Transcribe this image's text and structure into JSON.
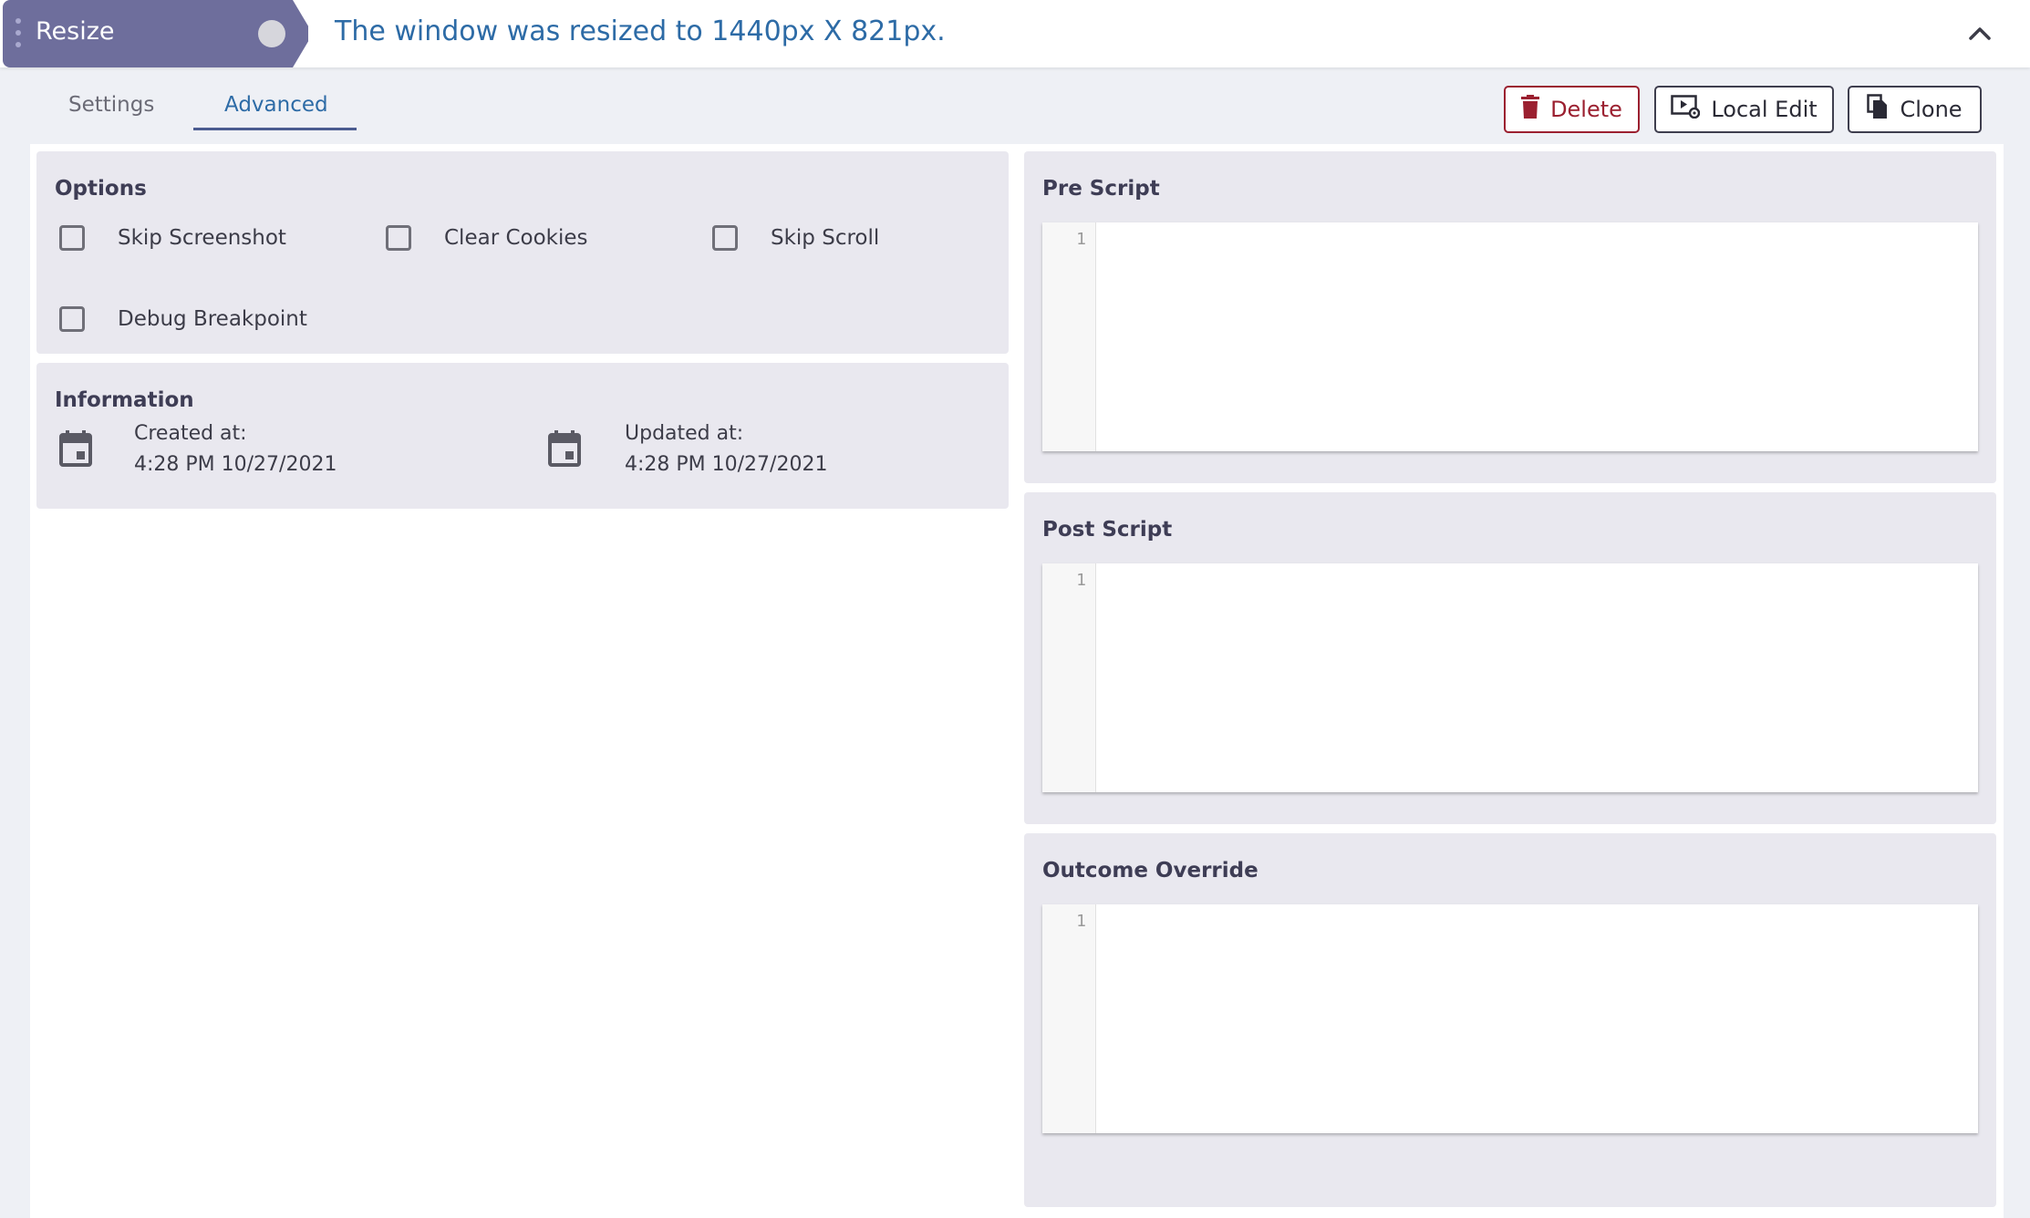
{
  "header": {
    "step_name": "Resize",
    "result_message": "The window was resized to 1440px X 821px.",
    "status_color": "#d6d6dc",
    "collapse_icon": "chevron-up-icon"
  },
  "tabs": {
    "items": [
      {
        "label": "Settings",
        "active": false
      },
      {
        "label": "Advanced",
        "active": true
      }
    ]
  },
  "actions": {
    "delete_label": "Delete",
    "delete_icon": "trash-icon",
    "local_edit_label": "Local Edit",
    "local_edit_icon": "screen-gear-icon",
    "clone_label": "Clone",
    "clone_icon": "copy-icon"
  },
  "options": {
    "title": "Options",
    "items": [
      {
        "label": "Skip Screenshot",
        "checked": false
      },
      {
        "label": "Clear Cookies",
        "checked": false
      },
      {
        "label": "Skip Scroll",
        "checked": false
      },
      {
        "label": "Debug Breakpoint",
        "checked": false
      }
    ]
  },
  "information": {
    "title": "Information",
    "created_label": "Created at:",
    "created_value": "4:28 PM 10/27/2021",
    "updated_label": "Updated at:",
    "updated_value": "4:28 PM 10/27/2021",
    "icon": "calendar-icon"
  },
  "scripts": {
    "pre": {
      "title": "Pre Script",
      "line_number": "1",
      "content": ""
    },
    "post": {
      "title": "Post Script",
      "line_number": "1",
      "content": ""
    },
    "outcome": {
      "title": "Outcome Override",
      "line_number": "1",
      "content": ""
    }
  },
  "colors": {
    "accent": "#2d6ba6",
    "step_tag": "#6e6e9c",
    "danger": "#9b2030",
    "panel_bg": "#e9e8ef"
  }
}
